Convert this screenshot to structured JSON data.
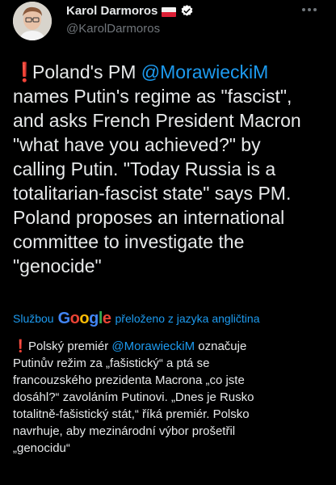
{
  "author": {
    "name": "Karol Darmoros",
    "handle": "@KarolDarmoros",
    "flag_icon": "poland-flag-icon",
    "verified_icon": "verified-badge-icon"
  },
  "tweet": {
    "mark": "❗",
    "lines": [
      [
        "Poland's PM ",
        "@MorawieckiM",
        ""
      ],
      [
        "names Putin's regime as \"fascist\",",
        "",
        ""
      ],
      [
        "and asks French President Macron",
        "",
        ""
      ],
      [
        "\"what have you achieved?\" by",
        "",
        ""
      ],
      [
        "calling Putin. \"Today Russia is a",
        "",
        ""
      ],
      [
        "totalitarian-fascist state\" says PM.",
        "",
        ""
      ],
      [
        "Poland proposes an international",
        "",
        ""
      ],
      [
        "committee to investigate the",
        "",
        ""
      ],
      [
        "\"genocide\"",
        "",
        ""
      ]
    ]
  },
  "translation": {
    "prefix": "Službou",
    "brand": "Google",
    "suffix": "přeloženo z jazyka angličtina"
  },
  "translated": {
    "mark": "❗",
    "lines": [
      [
        "Polský premiér ",
        "@MorawieckiM",
        " označuje"
      ],
      [
        "Putinův režim za „fašistický“ a ptá se",
        "",
        ""
      ],
      [
        "francouzského prezidenta Macrona „co jste",
        "",
        ""
      ],
      [
        "dosáhl?“ zavoláním Putinovi. „Dnes je Rusko",
        "",
        ""
      ],
      [
        "totalitně-fašistický stát,“ říká premiér. Polsko",
        "",
        ""
      ],
      [
        "navrhuje, aby mezinárodní výbor prošetřil",
        "",
        ""
      ],
      [
        "„genocidu“",
        "",
        ""
      ]
    ]
  },
  "colors": {
    "background": "#000000",
    "text": "#e7e9ea",
    "secondary": "#71767b",
    "link": "#1d9bf0",
    "alert": "#e0245e"
  }
}
